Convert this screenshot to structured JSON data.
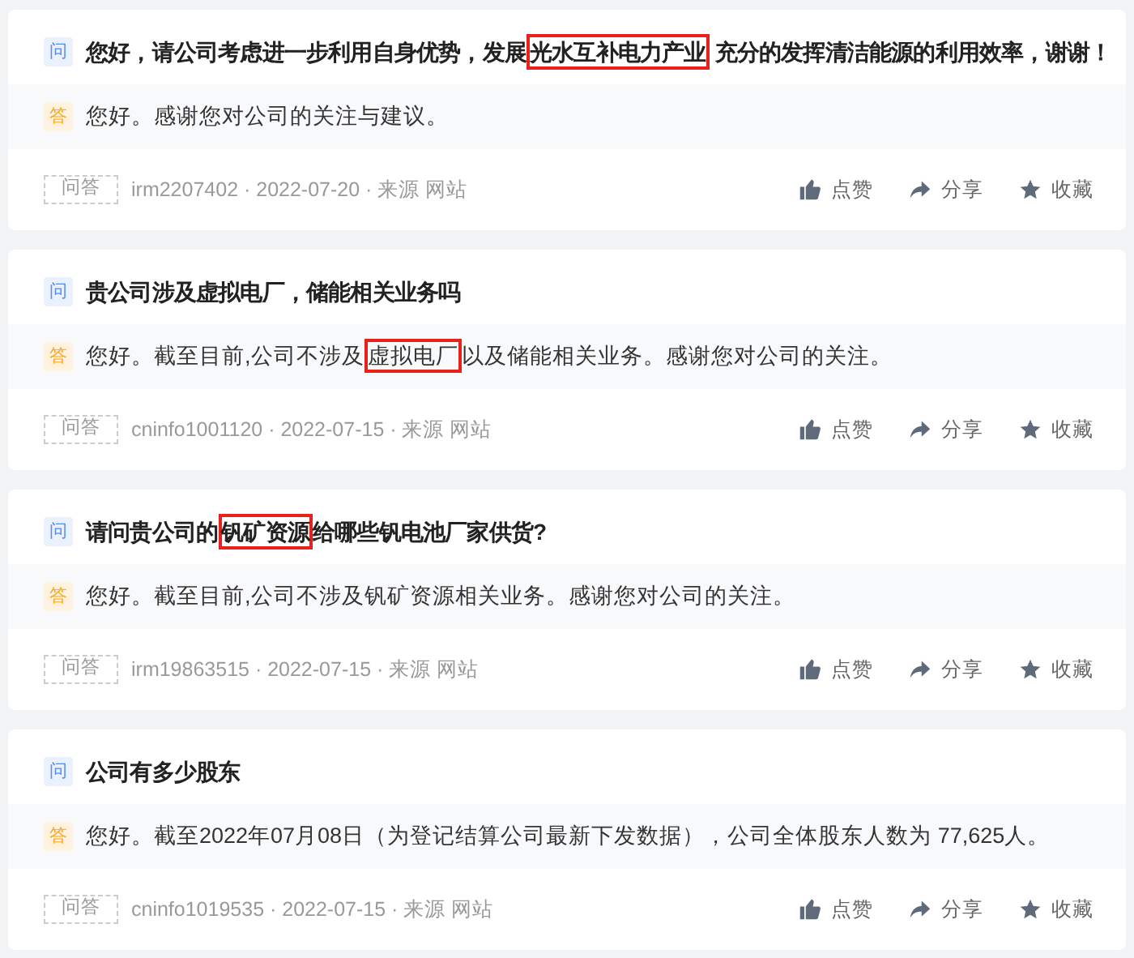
{
  "cards": [
    {
      "question_badge": "问",
      "question": [
        {
          "text": "您好，请公司考虑进一步利用自身优势，发展",
          "highlighted": false
        },
        {
          "text": "光水互补电力产业",
          "highlighted": true
        },
        {
          "text": " 充分的发挥清洁能源的利用效率，谢谢！",
          "highlighted": false
        }
      ],
      "answer_badge": "答",
      "answer": [
        {
          "text": "您好。感谢您对公司的关注与建议。",
          "highlighted": false
        }
      ],
      "tag": "问答",
      "meta": "irm2207402 · 2022-07-20 · 来源 网站",
      "actions": [
        "点赞",
        "分享",
        "收藏"
      ]
    },
    {
      "question_badge": "问",
      "question": [
        {
          "text": "贵公司涉及虚拟电厂，储能相关业务吗",
          "highlighted": false
        }
      ],
      "answer_badge": "答",
      "answer": [
        {
          "text": "您好。截至目前,公司不涉及",
          "highlighted": false
        },
        {
          "text": "虚拟电厂",
          "highlighted": true
        },
        {
          "text": "以及储能相关业务。感谢您对公司的关注。",
          "highlighted": false
        }
      ],
      "tag": "问答",
      "meta": "cninfo1001120 · 2022-07-15 · 来源 网站",
      "actions": [
        "点赞",
        "分享",
        "收藏"
      ]
    },
    {
      "question_badge": "问",
      "question": [
        {
          "text": "请问贵公司的",
          "highlighted": false
        },
        {
          "text": "钒矿资源",
          "highlighted": true
        },
        {
          "text": "给哪些钒电池厂家供货?",
          "highlighted": false
        }
      ],
      "answer_badge": "答",
      "answer": [
        {
          "text": "您好。截至目前,公司不涉及钒矿资源相关业务。感谢您对公司的关注。",
          "highlighted": false
        }
      ],
      "tag": "问答",
      "meta": "irm19863515 · 2022-07-15 · 来源 网站",
      "actions": [
        "点赞",
        "分享",
        "收藏"
      ]
    },
    {
      "question_badge": "问",
      "question": [
        {
          "text": "公司有多少股东",
          "highlighted": false
        }
      ],
      "answer_badge": "答",
      "answer": [
        {
          "text": "您好。截至2022年07月08日（为登记结算公司最新下发数据），公司全体股东人数为 77,625人。",
          "highlighted": false
        }
      ],
      "tag": "问答",
      "meta": "cninfo1019535 · 2022-07-15 · 来源 网站",
      "actions": [
        "点赞",
        "分享",
        "收藏"
      ]
    }
  ]
}
